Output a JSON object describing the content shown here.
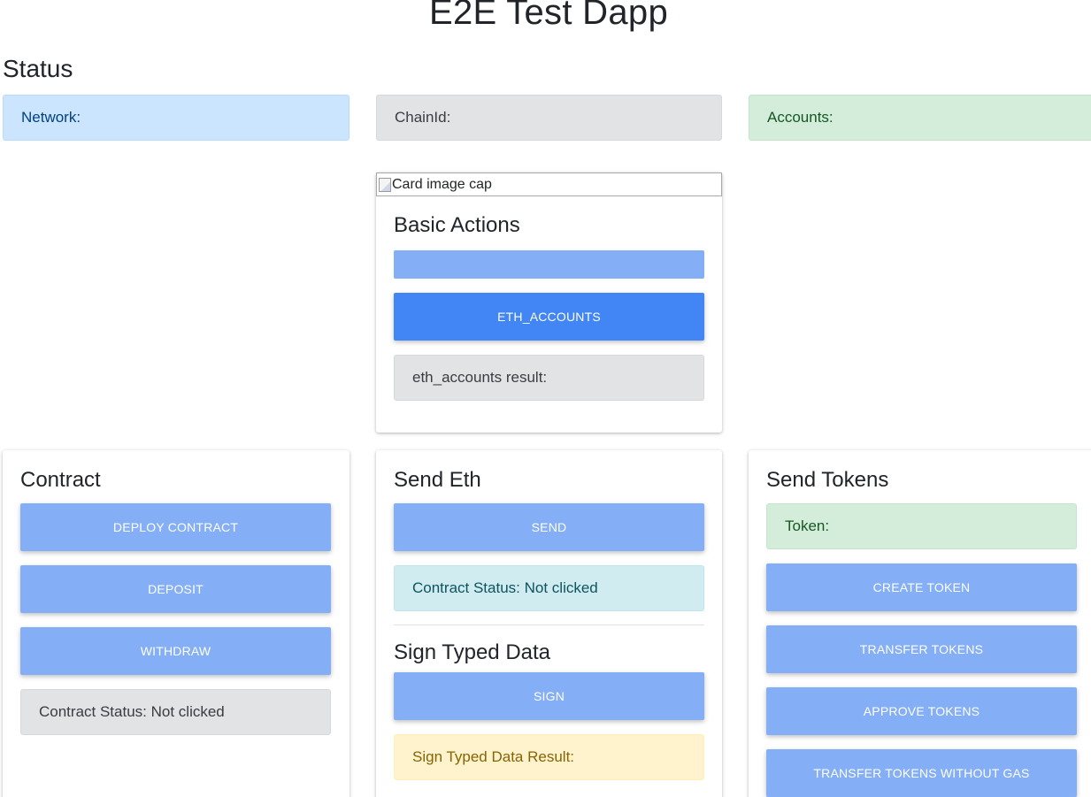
{
  "page": {
    "title": "E2E Test Dapp"
  },
  "status": {
    "heading": "Status",
    "network_label": "Network:",
    "chainid_label": "ChainId:",
    "accounts_label": "Accounts:"
  },
  "basic_actions": {
    "image_alt": "Card image cap",
    "title": "Basic Actions",
    "connect_button": "",
    "eth_accounts_button": "ETH_ACCOUNTS",
    "eth_accounts_result": "eth_accounts result:"
  },
  "contract": {
    "title": "Contract",
    "deploy_button": "DEPLOY CONTRACT",
    "deposit_button": "DEPOSIT",
    "withdraw_button": "WITHDRAW",
    "status": "Contract Status: Not clicked"
  },
  "send_eth": {
    "title": "Send Eth",
    "send_button": "SEND",
    "status": "Contract Status: Not clicked"
  },
  "sign_typed_data": {
    "title": "Sign Typed Data",
    "sign_button": "SIGN",
    "result": "Sign Typed Data Result:"
  },
  "send_tokens": {
    "title": "Send Tokens",
    "token_label": "Token:",
    "create_button": "CREATE TOKEN",
    "transfer_button": "TRANSFER TOKENS",
    "approve_button": "APPROVE TOKENS",
    "transfer_no_gas_button": "TRANSFER TOKENS WITHOUT GAS"
  },
  "colors": {
    "button": "#84aef5",
    "button_active": "#4285f4",
    "info_blue": "#cce5ff",
    "info_gray": "#e2e3e5",
    "info_green": "#d4edda",
    "info_teal": "#d1ecf1",
    "info_yellow": "#fff3cd"
  }
}
